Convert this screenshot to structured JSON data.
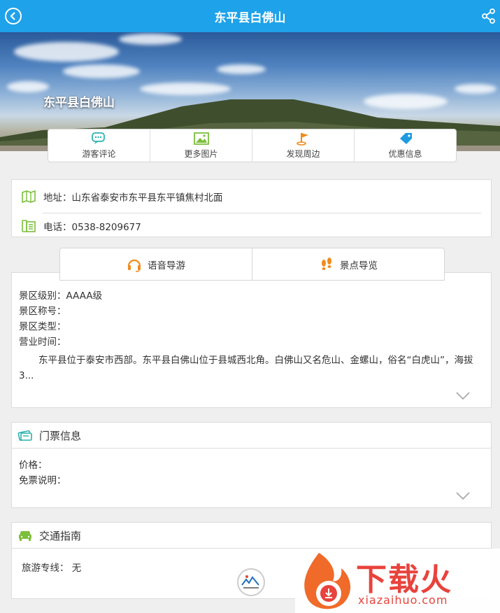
{
  "header": {
    "title": "东平县白佛山"
  },
  "banner": {
    "place_name": "东平县白佛山"
  },
  "actions": [
    {
      "label": "游客评论",
      "icon": "chat-icon"
    },
    {
      "label": "更多图片",
      "icon": "image-icon"
    },
    {
      "label": "发现周边",
      "icon": "flag-icon"
    },
    {
      "label": "优惠信息",
      "icon": "tag-icon"
    }
  ],
  "info": {
    "address": "地址：山东省泰安市东平县东平镇焦村北面",
    "phone": "电话：0538-8209677"
  },
  "tabs": {
    "audio_guide": "语音导游",
    "spot_guide": "景点导览"
  },
  "detail": {
    "level": "景区级别：AAAA级",
    "title_label": "景区称号：",
    "type_label": "景区类型：",
    "hours_label": "营业时间：",
    "description": "东平县位于泰安市西部。东平县白佛山位于县城西北角。白佛山又名危山、金螺山，俗名“白虎山”，海拔3..."
  },
  "ticket": {
    "title": "门票信息",
    "price_label": "价格：",
    "free_label": "免票说明："
  },
  "traffic": {
    "title": "交通指南",
    "route_label": "旅游专线： 无"
  },
  "watermark": {
    "brand": "下载火",
    "url": "xiazaihuo.com"
  },
  "colors": {
    "header": "#1ea2e9",
    "accent_orange": "#f08c1e",
    "watermark_red": "#e8433c"
  }
}
